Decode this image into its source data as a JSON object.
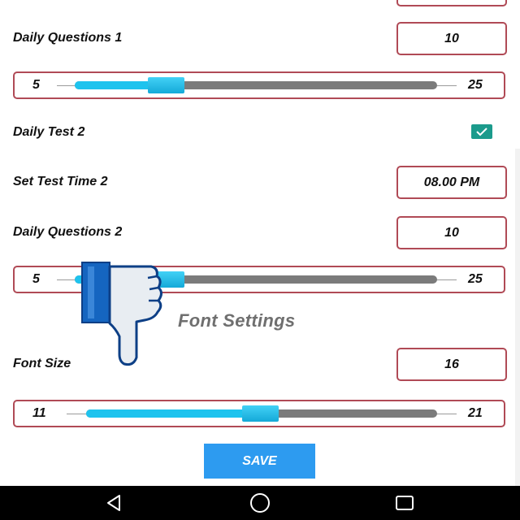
{
  "settings": {
    "daily_questions_1": {
      "label": "Daily Questions 1",
      "value": "10",
      "slider": {
        "min": "5",
        "max": "25",
        "value": 10
      }
    },
    "daily_test_2": {
      "label": "Daily Test 2",
      "checked": true
    },
    "set_test_time_2": {
      "label": "Set Test Time 2",
      "value": "08.00 PM"
    },
    "daily_questions_2": {
      "label": "Daily Questions 2",
      "value": "10",
      "slider": {
        "min": "5",
        "max": "25",
        "value": 10
      }
    }
  },
  "font_settings": {
    "title": "Font Settings",
    "font_size": {
      "label": "Font Size",
      "value": "16",
      "slider": {
        "min": "11",
        "max": "21",
        "value": 16
      }
    }
  },
  "actions": {
    "save_label": "SAVE"
  },
  "navbar": {
    "icons": [
      "back-icon",
      "home-icon",
      "recents-icon"
    ]
  },
  "colors": {
    "border_accent": "#b04a56",
    "slider_fill": "#1ec3ee",
    "checkbox": "#1b9b8c",
    "save_button": "#2d9bf0",
    "overlay_hand": "#1565c0"
  },
  "overlay": {
    "icon": "thumbs-down-icon"
  }
}
